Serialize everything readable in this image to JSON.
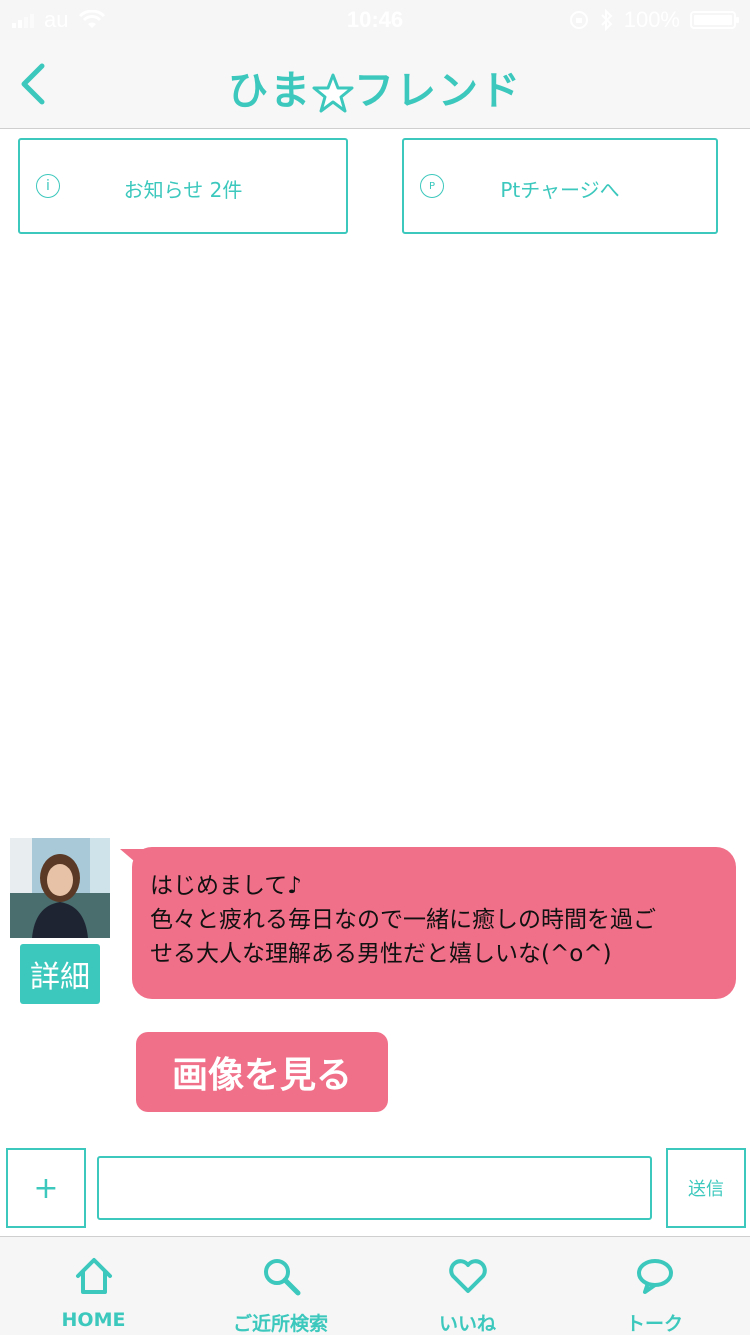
{
  "status_bar": {
    "carrier": "au",
    "time": "10:46",
    "battery": "100%"
  },
  "header": {
    "logo_text_left": "ひま",
    "logo_text_right": "フレンド"
  },
  "top_buttons": {
    "notices_label": "お知らせ 2件",
    "notices_icon": "i",
    "charge_label": "Ptチャージへ",
    "charge_icon": "P"
  },
  "message": {
    "detail_label": "詳細",
    "lines": [
      "はじめまして♪",
      "色々と疲れる毎日なので一緒に癒しの時間を過ご",
      "せる大人な理解ある男性だと嬉しいな(^o^)"
    ],
    "view_image_label": "画像を見る"
  },
  "compose": {
    "plus_label": "+",
    "input_value": "",
    "input_placeholder": "",
    "send_label": "送信"
  },
  "tabs": [
    {
      "label": "HOME",
      "icon": "home-icon"
    },
    {
      "label": "ご近所検索",
      "icon": "search-icon"
    },
    {
      "label": "いいね",
      "icon": "heart-icon"
    },
    {
      "label": "トーク",
      "icon": "chat-bubble-icon"
    }
  ],
  "colors": {
    "accent": "#3cc8bd",
    "bubble": "#f07089",
    "background": "#ffffff"
  }
}
